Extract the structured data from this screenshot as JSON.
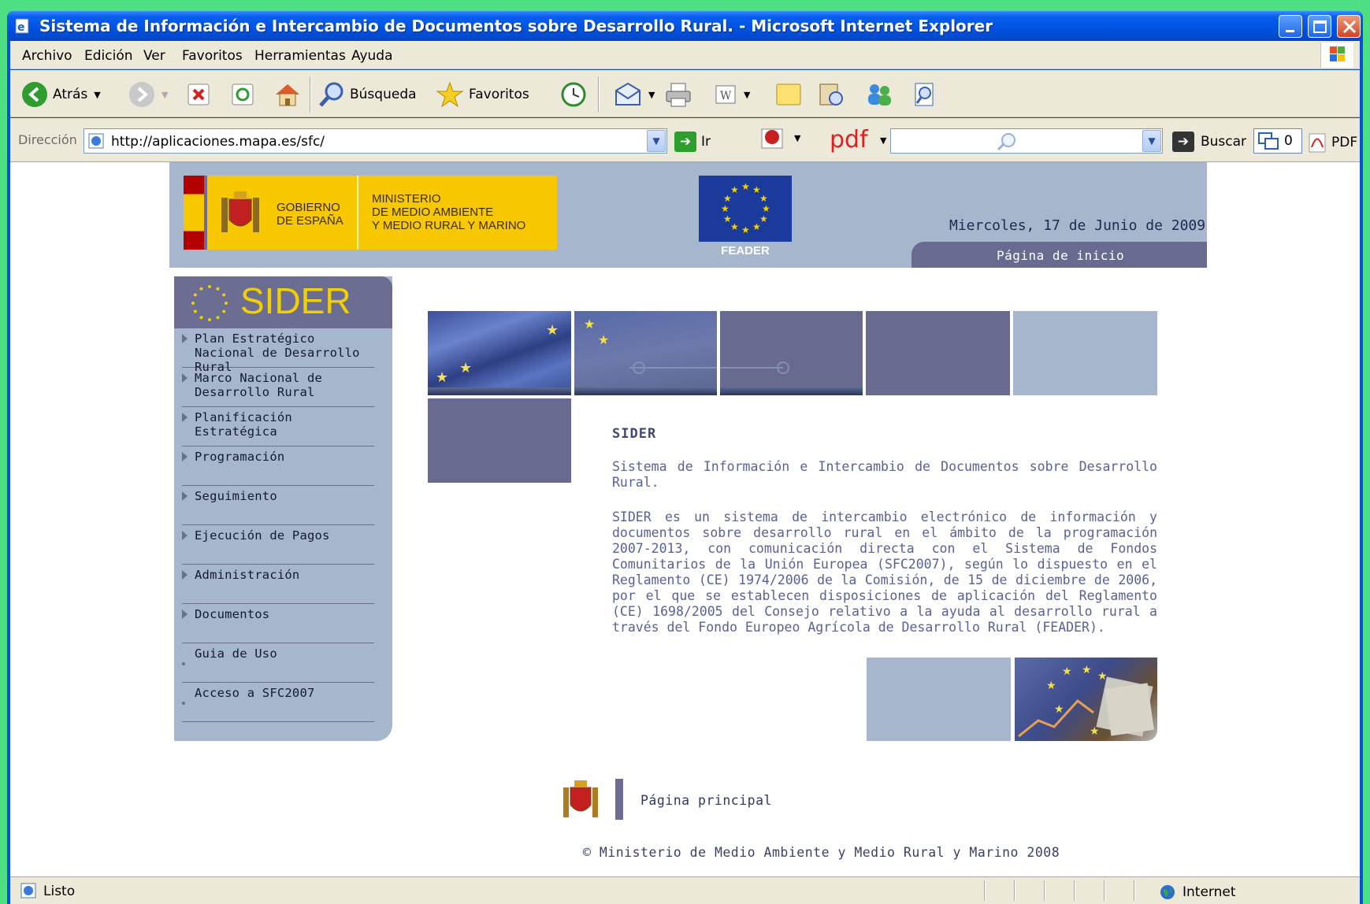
{
  "window": {
    "title": "Sistema de Información e Intercambio de Documentos sobre Desarrollo Rural. - Microsoft Internet Explorer"
  },
  "menu": [
    "Archivo",
    "Edición",
    "Ver",
    "Favoritos",
    "Herramientas",
    "Ayuda"
  ],
  "toolbar": {
    "back": "Atrás",
    "search": "Búsqueda",
    "favorites": "Favoritos"
  },
  "address": {
    "label": "Dirección",
    "url": "http://aplicaciones.mapa.es/sfc/",
    "go": "Ir",
    "pdf_brand": "pdf",
    "buscar": "Buscar",
    "counter": "0",
    "pdf": "PDF"
  },
  "header": {
    "gov_line1": "GOBIERNO",
    "gov_line2": "DE ESPAÑA",
    "ministry_line1": "MINISTERIO",
    "ministry_line2": "DE MEDIO AMBIENTE",
    "ministry_line3": "Y MEDIO RURAL Y MARINO",
    "feader": "FEADER",
    "date": "Miercoles, 17 de Junio de 2009",
    "home_tab": "Página de inicio"
  },
  "sidebar": {
    "brand": "SIDER",
    "items": [
      {
        "label": "Plan Estratégico Nacional de Desarrollo Rural",
        "marker": "triangle"
      },
      {
        "label": "Marco Nacional de Desarrollo Rural",
        "marker": "triangle"
      },
      {
        "label": "Planificación Estratégica",
        "marker": "triangle"
      },
      {
        "label": "Programación",
        "marker": "triangle"
      },
      {
        "label": "Seguimiento",
        "marker": "triangle"
      },
      {
        "label": "Ejecución de Pagos",
        "marker": "triangle"
      },
      {
        "label": "Administración",
        "marker": "triangle"
      },
      {
        "label": "Documentos",
        "marker": "triangle"
      },
      {
        "label": "Guia de Uso",
        "marker": "dot"
      },
      {
        "label": "Acceso a SFC2007",
        "marker": "dot"
      }
    ]
  },
  "content": {
    "title": "SIDER",
    "subtitle": "Sistema de Información e Intercambio de Documentos sobre Desarrollo Rural.",
    "body": "SIDER es un sistema de intercambio electrónico de información y documentos sobre desarrollo rural en el ámbito de la programación 2007-2013, con comunicación directa con el Sistema de Fondos Comunitarios de la Unión Europea (SFC2007), según lo dispuesto en el Reglamento (CE) 1974/2006 de la Comisión, de 15 de diciembre de 2006, por el que se establecen disposiciones de aplicación del Reglamento (CE) 1698/2005 del Consejo relativo a la ayuda al desarrollo rural a través del Fondo Europeo Agrícola de Desarrollo Rural (FEADER)."
  },
  "footer": {
    "link": "Página principal",
    "copyright": "© Ministerio de Medio Ambiente y Medio Rural y Marino 2008"
  },
  "status": {
    "text": "Listo",
    "zone": "Internet"
  },
  "colors": {
    "header_bg": "#a6b6cc",
    "nav_dark": "#686b8f",
    "sider_yellow": "#f2d000",
    "xp_blue": "#0a4fe0"
  }
}
